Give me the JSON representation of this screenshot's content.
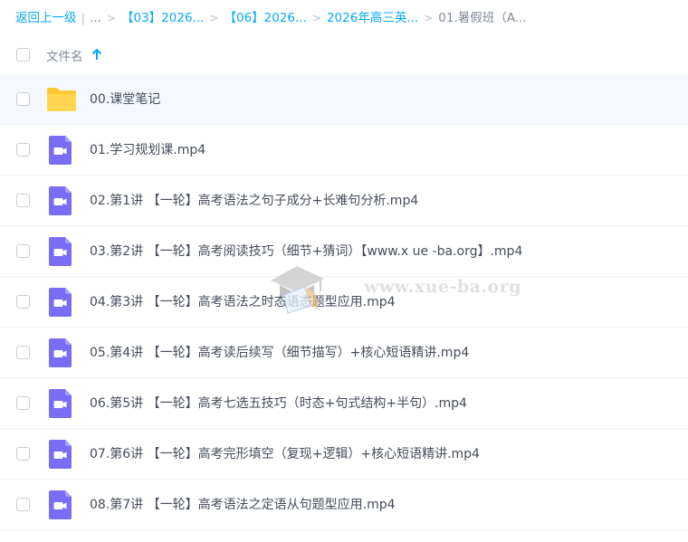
{
  "breadcrumb": {
    "back_label": "返回上一级",
    "ellipsis": "...",
    "items": [
      "【03】2026...",
      "【06】2026...",
      "2026年高三英...",
      "01.暑假班（A..."
    ]
  },
  "header": {
    "column_title": "文件名",
    "sort_icon": "arrow-up-icon",
    "accent_color": "#06a7ff"
  },
  "rows": [
    {
      "name": "00.课堂笔记",
      "type": "folder"
    },
    {
      "name": "01.学习规划课.mp4",
      "type": "video"
    },
    {
      "name": "02.第1讲 【一轮】高考语法之句子成分+长难句分析.mp4",
      "type": "video"
    },
    {
      "name": "03.第2讲 【一轮】高考阅读技巧（细节+猜词）【www.x ue -ba.org】.mp4",
      "type": "video"
    },
    {
      "name": "04.第3讲 【一轮】高考语法之时态语态题型应用.mp4",
      "type": "video"
    },
    {
      "name": "05.第4讲 【一轮】高考读后续写（细节描写）+核心短语精讲.mp4",
      "type": "video"
    },
    {
      "name": "06.第5讲 【一轮】高考七选五技巧（时态+句式结构+半句）.mp4",
      "type": "video"
    },
    {
      "name": "07.第6讲 【一轮】高考完形填空（复现+逻辑）+核心短语精讲.mp4",
      "type": "video"
    },
    {
      "name": "08.第7讲 【一轮】高考语法之定语从句题型应用.mp4",
      "type": "video"
    }
  ],
  "icons": {
    "folder_color": "#ffd04b",
    "video_color": "#7b6cf6"
  },
  "watermark": {
    "text": "www.xue-ba.org"
  }
}
